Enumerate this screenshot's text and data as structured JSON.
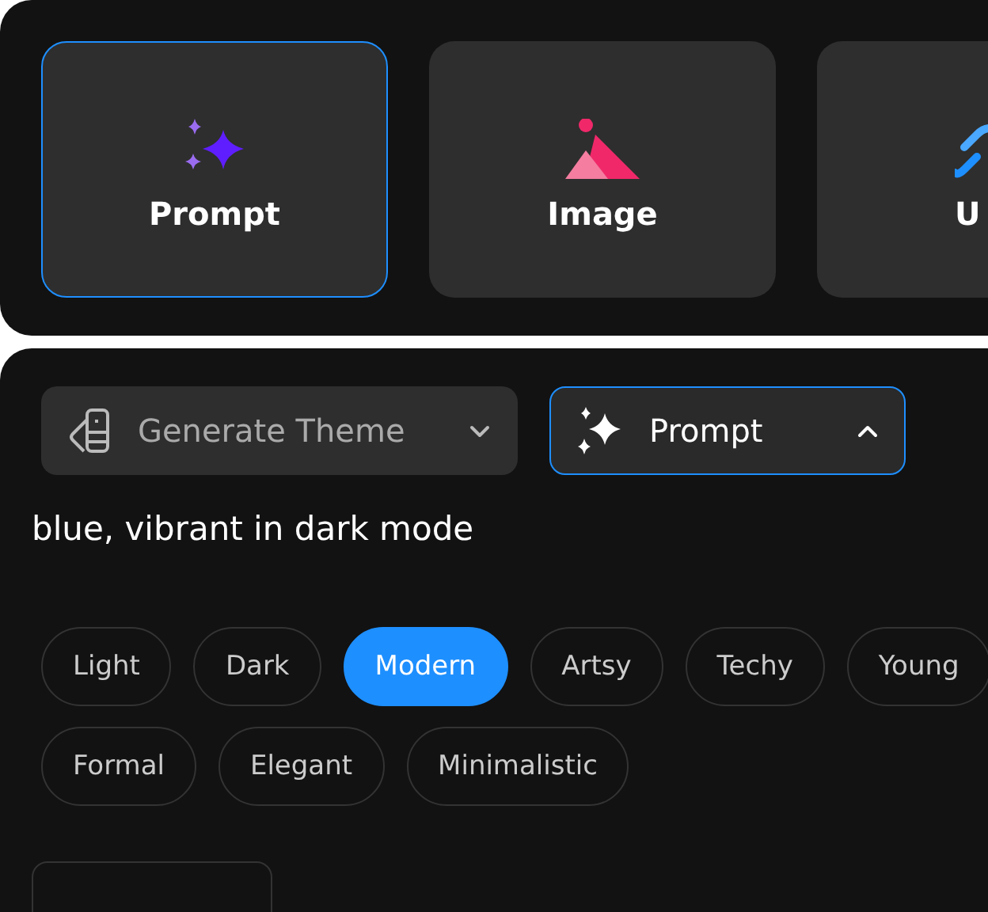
{
  "sources": [
    {
      "label": "Prompt",
      "kind": "prompt",
      "selected": true
    },
    {
      "label": "Image",
      "kind": "image",
      "selected": false
    },
    {
      "label": "U",
      "kind": "link",
      "selected": false
    }
  ],
  "theme_select": {
    "label": "Generate Theme",
    "expanded": false
  },
  "mode_select": {
    "label": "Prompt",
    "expanded": true
  },
  "prompt_text": "blue, vibrant in dark mode",
  "styles": [
    {
      "label": "Light",
      "selected": false
    },
    {
      "label": "Dark",
      "selected": false
    },
    {
      "label": "Modern",
      "selected": true
    },
    {
      "label": "Artsy",
      "selected": false
    },
    {
      "label": "Techy",
      "selected": false
    },
    {
      "label": "Young",
      "selected": false
    },
    {
      "label": "Formal",
      "selected": false
    },
    {
      "label": "Elegant",
      "selected": false
    },
    {
      "label": "Minimalistic",
      "selected": false
    }
  ]
}
